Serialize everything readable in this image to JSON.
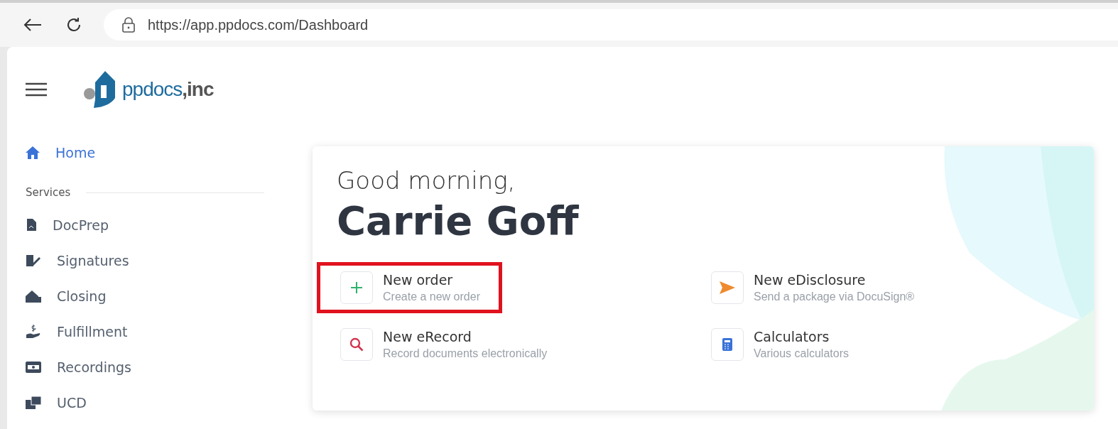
{
  "browser": {
    "url": "https://app.ppdocs.com/Dashboard"
  },
  "logo": {
    "text": "ppdocs**,inc**"
  },
  "sidebar": {
    "home": {
      "label": "Home",
      "selected": true
    },
    "section": "Services",
    "items": [
      {
        "label": "DocPrep",
        "selected": false
      },
      {
        "label": "Signatures",
        "selected": false
      },
      {
        "label": "Closing",
        "selected": false
      },
      {
        "label": "Fulfillment",
        "selected": false
      },
      {
        "label": "Recordings",
        "selected": false
      },
      {
        "label": "UCD",
        "selected": false
      }
    ]
  },
  "greeting": {
    "line": "Good morning,",
    "name": "Carrie Goff"
  },
  "actions": [
    {
      "kind": "plus",
      "title": "New order",
      "subtitle": "Create a new order",
      "highlighted": true
    },
    {
      "kind": "send",
      "title": "New eDisclosure",
      "subtitle": "Send a package via DocuSign®",
      "highlighted": false
    },
    {
      "kind": "search",
      "title": "New eRecord",
      "subtitle": "Record documents electronically",
      "highlighted": false
    },
    {
      "kind": "calc",
      "title": "Calculators",
      "subtitle": "Various calculators",
      "highlighted": false
    }
  ]
}
